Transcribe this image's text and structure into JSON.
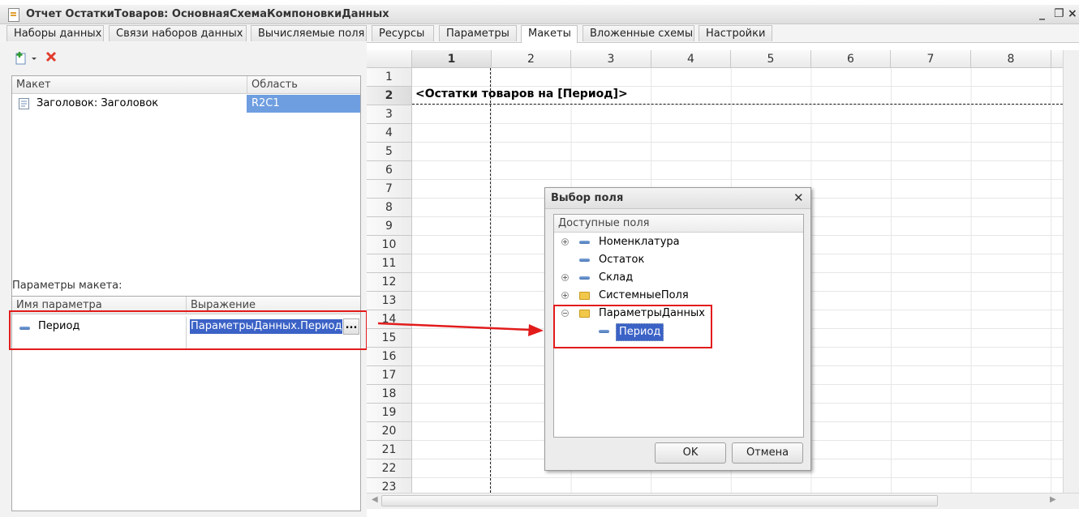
{
  "window": {
    "title": "Отчет ОстаткиТоваров: ОсновнаяСхемаКомпоновкиДанных",
    "controls": [
      "_",
      "❐",
      "×"
    ]
  },
  "tabs": [
    {
      "label": "Наборы данных",
      "active": false
    },
    {
      "label": "Связи наборов данных",
      "active": false
    },
    {
      "label": "Вычисляемые поля",
      "active": false
    },
    {
      "label": "Ресурсы",
      "active": false
    },
    {
      "label": "Параметры",
      "active": false
    },
    {
      "label": "Макеты",
      "active": true
    },
    {
      "label": "Вложенные схемы",
      "active": false
    },
    {
      "label": "Настройки",
      "active": false
    }
  ],
  "layouts_table": {
    "columns": [
      "Макет",
      "Область"
    ],
    "rows": [
      {
        "name": "Заголовок: Заголовок",
        "area": "R2C1"
      }
    ]
  },
  "params": {
    "label": "Параметры макета:",
    "columns": [
      "Имя параметра",
      "Выражение"
    ],
    "rows": [
      {
        "name": "Период",
        "expression": "ПараметрыДанных.Период",
        "button": "..."
      }
    ]
  },
  "sheet": {
    "columns": [
      "1",
      "2",
      "3",
      "4",
      "5",
      "6",
      "7",
      "8"
    ],
    "rows": [
      "1",
      "2",
      "3",
      "4",
      "5",
      "6",
      "7",
      "8",
      "9",
      "10",
      "11",
      "12",
      "13",
      "14",
      "15",
      "16",
      "17",
      "18",
      "19",
      "20",
      "21",
      "22",
      "23"
    ],
    "cell_r2c1": "<Остатки товаров на [Период]>"
  },
  "dialog": {
    "title": "Выбор поля",
    "close": "✕",
    "tree_header": "Доступные поля",
    "items": [
      {
        "label": "Номенклатура",
        "kind": "field",
        "expander": "plus"
      },
      {
        "label": "Остаток",
        "kind": "field",
        "expander": "none"
      },
      {
        "label": "Склад",
        "kind": "field",
        "expander": "plus"
      },
      {
        "label": "СистемныеПоля",
        "kind": "folder",
        "expander": "plus"
      },
      {
        "label": "ПараметрыДанных",
        "kind": "folder",
        "expander": "minus"
      },
      {
        "label": "Период",
        "kind": "field",
        "expander": "none",
        "selected": true
      }
    ],
    "ok": "OK",
    "cancel": "Отмена"
  },
  "colors": {
    "selection": "#3b62c6",
    "annotation": "#e21b1b",
    "area_cell_bg": "#6f9ee0"
  }
}
